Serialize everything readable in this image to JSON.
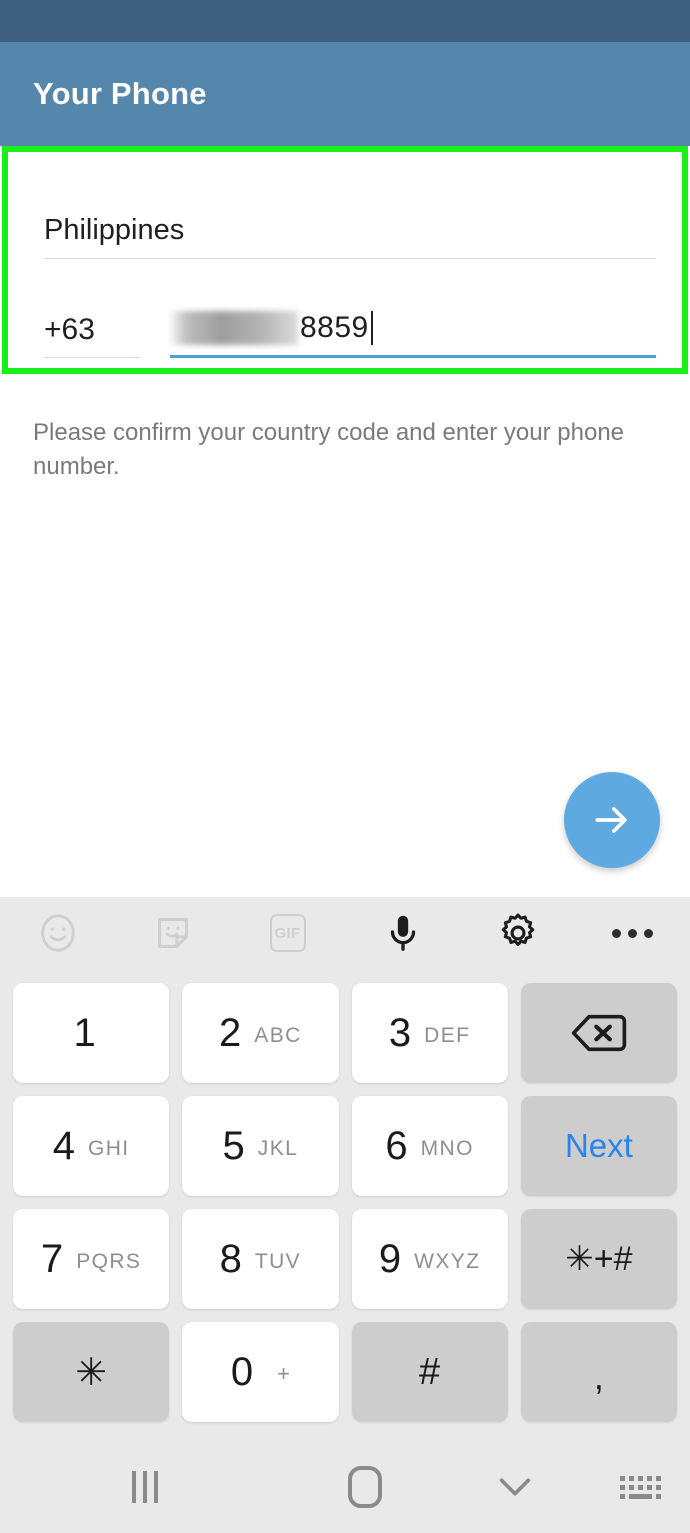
{
  "status_bar": {
    "background": "#3d5f7d"
  },
  "app_bar": {
    "title": "Your Phone",
    "background": "#5586ac",
    "title_color": "#ffffff"
  },
  "highlight": {
    "color": "#18f018"
  },
  "form": {
    "country_field": {
      "name": "country-input",
      "value": "Philippines"
    },
    "country_code_field": {
      "name": "country-code-input",
      "value": "+63"
    },
    "phone_number_field": {
      "name": "phone-number-input",
      "visible_digits": "8859",
      "redacted": true,
      "underline_color": "#4a9fdc",
      "focused": true
    }
  },
  "helper_text": "Please confirm your country code and enter your phone number.",
  "fab": {
    "name": "next-fab",
    "icon": "arrow-right-icon",
    "color": "#5eaae0"
  },
  "keyboard": {
    "background": "#e9e9e9",
    "toolbar": [
      {
        "icon": "emoji-icon",
        "label": ""
      },
      {
        "icon": "sticker-icon",
        "label": ""
      },
      {
        "icon": "gif-icon",
        "label": "GIF"
      },
      {
        "icon": "microphone-icon",
        "label": ""
      },
      {
        "icon": "gear-icon",
        "label": ""
      },
      {
        "icon": "more-options-icon",
        "label": ""
      }
    ],
    "rows": [
      [
        {
          "num": "1",
          "letters": "",
          "style": "white",
          "type": "digit"
        },
        {
          "num": "2",
          "letters": "ABC",
          "style": "white",
          "type": "digit"
        },
        {
          "num": "3",
          "letters": "DEF",
          "style": "white",
          "type": "digit"
        },
        {
          "num": "",
          "letters": "",
          "style": "gray",
          "type": "backspace",
          "icon": "backspace-icon"
        }
      ],
      [
        {
          "num": "4",
          "letters": "GHI",
          "style": "white",
          "type": "digit"
        },
        {
          "num": "5",
          "letters": "JKL",
          "style": "white",
          "type": "digit"
        },
        {
          "num": "6",
          "letters": "MNO",
          "style": "white",
          "type": "digit"
        },
        {
          "num": "Next",
          "letters": "",
          "style": "gray",
          "type": "action"
        }
      ],
      [
        {
          "num": "7",
          "letters": "PQRS",
          "style": "white",
          "type": "digit"
        },
        {
          "num": "8",
          "letters": "TUV",
          "style": "white",
          "type": "digit"
        },
        {
          "num": "9",
          "letters": "WXYZ",
          "style": "white",
          "type": "digit"
        },
        {
          "num": "✳+#",
          "letters": "",
          "style": "gray",
          "type": "symbols"
        }
      ],
      [
        {
          "num": "✳",
          "letters": "",
          "style": "gray",
          "type": "star"
        },
        {
          "num": "0",
          "letters": "+",
          "style": "white",
          "type": "digit"
        },
        {
          "num": "#",
          "letters": "",
          "style": "gray",
          "type": "hash"
        },
        {
          "num": ",",
          "letters": "",
          "style": "gray",
          "type": "comma"
        }
      ]
    ],
    "next_key_color": "#2a84f0"
  },
  "nav_bar": {
    "items": [
      {
        "icon": "recents-icon"
      },
      {
        "icon": "home-icon"
      },
      {
        "icon": "chevron-down-icon"
      },
      {
        "icon": "keyboard-switch-icon"
      }
    ]
  }
}
